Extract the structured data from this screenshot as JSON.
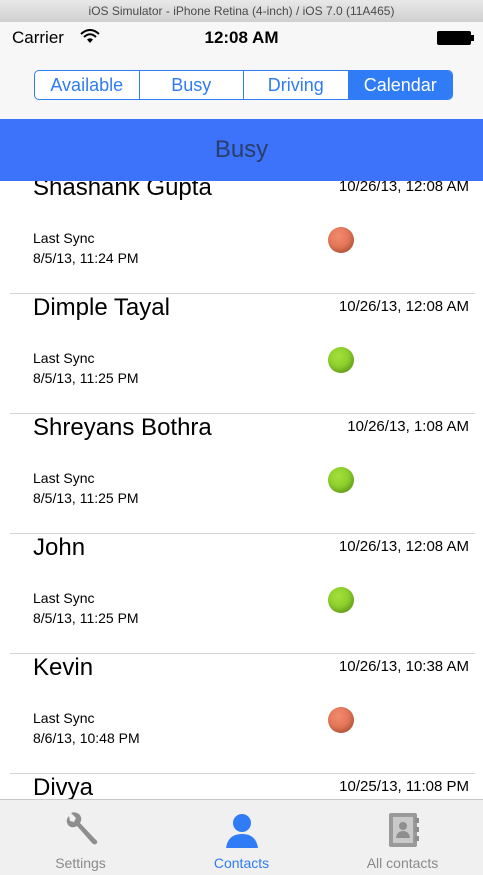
{
  "window": {
    "title": "iOS Simulator - iPhone Retina (4-inch) / iOS 7.0 (11A465)"
  },
  "status_bar": {
    "carrier": "Carrier",
    "time": "12:08 AM"
  },
  "segments": [
    {
      "label": "Available",
      "active": false
    },
    {
      "label": "Busy",
      "active": false
    },
    {
      "label": "Driving",
      "active": false
    },
    {
      "label": "Calendar",
      "active": true
    }
  ],
  "header": {
    "title": "Busy"
  },
  "contacts": [
    {
      "name": "Shashank Gupta",
      "date": "10/26/13, 12:08 AM",
      "sync_label": "Last Sync",
      "sync_date": "8/5/13, 11:24 PM",
      "status": "busy"
    },
    {
      "name": "Dimple Tayal",
      "date": "10/26/13, 12:08 AM",
      "sync_label": "Last Sync",
      "sync_date": "8/5/13, 11:25 PM",
      "status": "available"
    },
    {
      "name": "Shreyans Bothra",
      "date": "10/26/13, 1:08 AM",
      "sync_label": "Last Sync",
      "sync_date": "8/5/13, 11:25 PM",
      "status": "available"
    },
    {
      "name": "John",
      "date": "10/26/13, 12:08 AM",
      "sync_label": "Last Sync",
      "sync_date": "8/5/13, 11:25 PM",
      "status": "available"
    },
    {
      "name": "Kevin",
      "date": "10/26/13, 10:38 AM",
      "sync_label": "Last Sync",
      "sync_date": "8/6/13, 10:48 PM",
      "status": "busy"
    },
    {
      "name": "Divya",
      "date": "10/25/13, 11:08 PM",
      "sync_label": "",
      "sync_date": "",
      "status": ""
    }
  ],
  "tabs": [
    {
      "label": "Settings",
      "icon": "wrench-icon",
      "active": false
    },
    {
      "label": "Contacts",
      "icon": "person-icon",
      "active": true
    },
    {
      "label": "All contacts",
      "icon": "address-book-icon",
      "active": false
    }
  ],
  "colors": {
    "accent": "#2f7cf6",
    "header_band": "#3d73fb",
    "busy_dot": "#d9613f",
    "available_dot": "#6fbe1a"
  }
}
